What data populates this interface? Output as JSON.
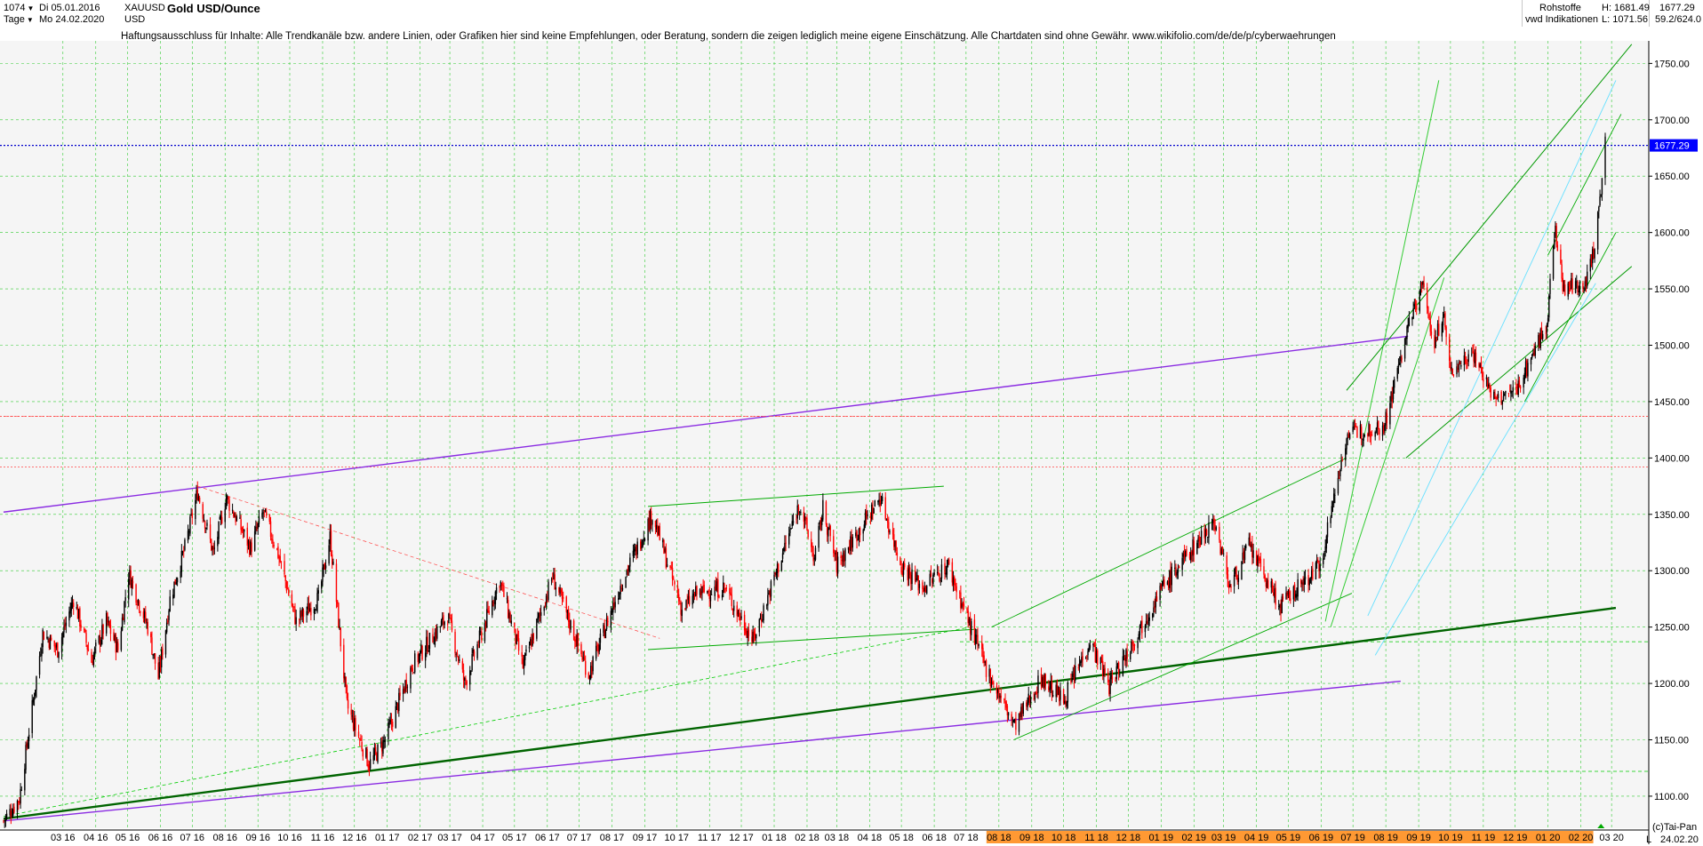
{
  "header": {
    "bars": "1074",
    "date_from": "Di 05.01.2016",
    "period": "Tage",
    "date_to": "Mo 24.02.2020",
    "symbol": "XAUUSD",
    "currency": "USD",
    "title": "Gold USD/Ounce",
    "disclaimer": "Haftungsausschluss für Inhalte: Alle Trendkanäle bzw. andere Linien, oder Grafiken hier sind keine Empfehlungen, oder Beratung, sondern die zeigen lediglich meine eigene Einschätzung. Alle Chartdaten sind ohne Gewähr.  www.wikifolio.com/de/de/p/cyberwaehrungen",
    "category": "Rohstoffe",
    "source": "vwd Indikationen",
    "high": "H:  1681.49",
    "low": "L:  1071.56",
    "last": "1677.29",
    "range": "59.2/624.0"
  },
  "footer": {
    "copyright": "(c)Tai-Pan",
    "l_marker": "L",
    "end_date": "24.02.20"
  },
  "colors": {
    "up_candle": "#000000",
    "down_candle": "#ff0000",
    "grid": "#33cc33",
    "last_price_line": "#0000cc",
    "last_price_tag": "#0000ff",
    "purple_line": "#8a2be2",
    "green_line": "#006400",
    "light_green_line": "#00cc00",
    "cyan_line": "#66e0ff",
    "red_dashed": "#ff4444",
    "x_axis_highlight": "#ff9933"
  },
  "chart_data": {
    "type": "candlestick",
    "title": "Gold USD/Ounce",
    "y_range": [
      1071.56,
      1770
    ],
    "y_ticks": [
      1100,
      1150,
      1200,
      1250,
      1300,
      1350,
      1400,
      1450,
      1500,
      1550,
      1600,
      1650,
      1700,
      1750
    ],
    "y_tick_labels": [
      "1100.00",
      "1150.00",
      "1200.00",
      "1250.00",
      "1300.00",
      "1350.00",
      "1400.00",
      "1450.00",
      "1500.00",
      "1550.00",
      "1600.00",
      "1650.00",
      "1700.00",
      "1750.00"
    ],
    "x_ticks": [
      "03 16",
      "04 16",
      "05 16",
      "06 16",
      "07 16",
      "08 16",
      "09 16",
      "10 16",
      "11 16",
      "12 16",
      "01 17",
      "02 17",
      "03 17",
      "04 17",
      "05 17",
      "06 17",
      "07 17",
      "08 17",
      "09 17",
      "10 17",
      "11 17",
      "12 17",
      "01 18",
      "02 18",
      "03 18",
      "04 18",
      "05 18",
      "06 18",
      "07 18",
      "08 18",
      "09 18",
      "10 18",
      "11 18",
      "12 18",
      "01 19",
      "02 19",
      "03 19",
      "04 19",
      "05 19",
      "06 19",
      "07 19",
      "08 19",
      "09 19",
      "10 19",
      "11 19",
      "12 19",
      "01 20",
      "02 20",
      "03 20"
    ],
    "x_tick_dates": [
      "2016-03-01",
      "2016-04-01",
      "2016-05-01",
      "2016-06-01",
      "2016-07-01",
      "2016-08-01",
      "2016-09-01",
      "2016-10-01",
      "2016-11-01",
      "2016-12-01",
      "2017-01-01",
      "2017-02-01",
      "2017-03-01",
      "2017-04-01",
      "2017-05-01",
      "2017-06-01",
      "2017-07-01",
      "2017-08-01",
      "2017-09-01",
      "2017-10-01",
      "2017-11-01",
      "2017-12-01",
      "2018-01-01",
      "2018-02-01",
      "2018-03-01",
      "2018-04-01",
      "2018-05-01",
      "2018-06-01",
      "2018-07-01",
      "2018-08-01",
      "2018-09-01",
      "2018-10-01",
      "2018-11-01",
      "2018-12-01",
      "2019-01-01",
      "2019-02-01",
      "2019-03-01",
      "2019-04-01",
      "2019-05-01",
      "2019-06-01",
      "2019-07-01",
      "2019-08-01",
      "2019-09-01",
      "2019-10-01",
      "2019-11-01",
      "2019-12-01",
      "2020-01-01",
      "2020-02-01",
      "2020-03-01"
    ],
    "highlighted_x_ticks": [
      "08 18",
      "09 18",
      "10 18",
      "11 18",
      "12 18",
      "01 19",
      "02 19",
      "03 19",
      "04 19",
      "05 19",
      "06 19",
      "07 19",
      "08 19",
      "09 19",
      "10 19",
      "11 19",
      "12 19",
      "01 20",
      "02 20"
    ],
    "last_price": 1677.29,
    "price_path": [
      [
        "2016-01-05",
        1078
      ],
      [
        "2016-01-20",
        1098
      ],
      [
        "2016-02-11",
        1245
      ],
      [
        "2016-02-25",
        1230
      ],
      [
        "2016-03-11",
        1275
      ],
      [
        "2016-03-28",
        1220
      ],
      [
        "2016-04-11",
        1255
      ],
      [
        "2016-04-22",
        1230
      ],
      [
        "2016-05-02",
        1298
      ],
      [
        "2016-05-20",
        1250
      ],
      [
        "2016-05-30",
        1205
      ],
      [
        "2016-06-10",
        1275
      ],
      [
        "2016-06-24",
        1320
      ],
      [
        "2016-07-06",
        1370
      ],
      [
        "2016-07-21",
        1315
      ],
      [
        "2016-08-02",
        1365
      ],
      [
        "2016-08-25",
        1320
      ],
      [
        "2016-09-06",
        1352
      ],
      [
        "2016-09-20",
        1315
      ],
      [
        "2016-10-07",
        1255
      ],
      [
        "2016-10-28",
        1275
      ],
      [
        "2016-11-08",
        1330
      ],
      [
        "2016-11-24",
        1180
      ],
      [
        "2016-12-15",
        1128
      ],
      [
        "2016-12-30",
        1150
      ],
      [
        "2017-01-24",
        1215
      ],
      [
        "2017-02-27",
        1260
      ],
      [
        "2017-03-15",
        1200
      ],
      [
        "2017-04-17",
        1292
      ],
      [
        "2017-05-09",
        1215
      ],
      [
        "2017-06-06",
        1295
      ],
      [
        "2017-07-10",
        1208
      ],
      [
        "2017-08-10",
        1290
      ],
      [
        "2017-09-08",
        1350
      ],
      [
        "2017-10-06",
        1265
      ],
      [
        "2017-10-20",
        1280
      ],
      [
        "2017-11-15",
        1285
      ],
      [
        "2017-12-12",
        1238
      ],
      [
        "2018-01-25",
        1360
      ],
      [
        "2018-02-08",
        1310
      ],
      [
        "2018-02-16",
        1355
      ],
      [
        "2018-03-01",
        1305
      ],
      [
        "2018-04-11",
        1365
      ],
      [
        "2018-05-01",
        1305
      ],
      [
        "2018-05-21",
        1285
      ],
      [
        "2018-06-14",
        1305
      ],
      [
        "2018-07-19",
        1215
      ],
      [
        "2018-08-16",
        1162
      ],
      [
        "2018-09-10",
        1205
      ],
      [
        "2018-10-01",
        1185
      ],
      [
        "2018-10-26",
        1238
      ],
      [
        "2018-11-13",
        1198
      ],
      [
        "2018-12-31",
        1282
      ],
      [
        "2019-02-20",
        1345
      ],
      [
        "2019-03-07",
        1285
      ],
      [
        "2019-03-25",
        1322
      ],
      [
        "2019-04-23",
        1268
      ],
      [
        "2019-05-31",
        1305
      ],
      [
        "2019-06-25",
        1420
      ],
      [
        "2019-07-31",
        1430
      ],
      [
        "2019-08-19",
        1505
      ],
      [
        "2019-09-04",
        1555
      ],
      [
        "2019-09-16",
        1500
      ],
      [
        "2019-09-24",
        1530
      ],
      [
        "2019-10-01",
        1475
      ],
      [
        "2019-10-22",
        1495
      ],
      [
        "2019-11-12",
        1450
      ],
      [
        "2019-12-02",
        1460
      ],
      [
        "2019-12-31",
        1520
      ],
      [
        "2020-01-08",
        1605
      ],
      [
        "2020-01-15",
        1550
      ],
      [
        "2020-02-04",
        1555
      ],
      [
        "2020-02-14",
        1585
      ],
      [
        "2020-02-24",
        1677.29
      ]
    ],
    "horizontal_levels": [
      {
        "value": 1677.29,
        "style": "dotted",
        "color": "blue"
      },
      {
        "value": 1437,
        "style": "dotted",
        "color": "red"
      },
      {
        "value": 1392,
        "style": "dotted",
        "color": "red"
      },
      {
        "value": 1237,
        "style": "dashed",
        "color": "green"
      },
      {
        "value": 1122,
        "style": "dashed",
        "color": "green"
      }
    ]
  }
}
